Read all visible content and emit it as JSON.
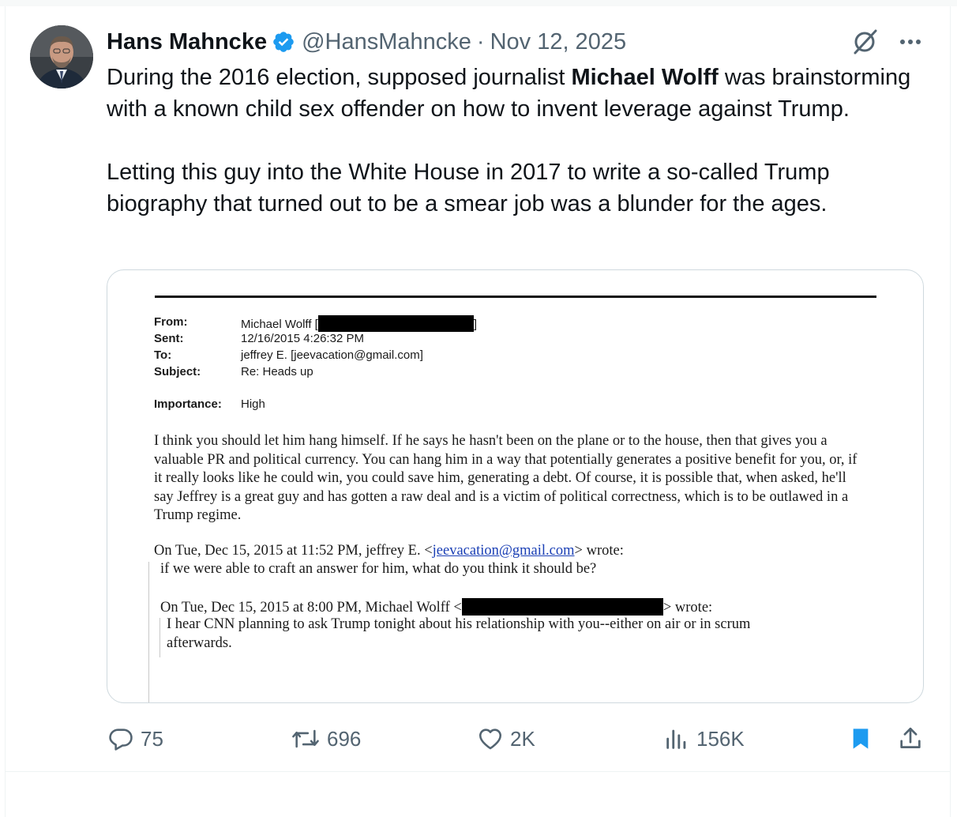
{
  "author": {
    "name": "Hans Mahncke",
    "handle": "@HansMahncke",
    "separator": "·",
    "date": "Nov 12, 2025"
  },
  "tweet": {
    "line1_before": "During the 2016 election, supposed journalist ",
    "line1_bold": "Michael Wolff",
    "line1_after": " was brainstorming with a known child sex offender on how to invent leverage against Trump.",
    "paragraph2": "Letting this guy into the White House in 2017 to write a so-called Trump biography that turned out to be a smear job was a blunder for the ages."
  },
  "document": {
    "from_label": "From:",
    "from_value": "Michael Wolff [",
    "from_close": "]",
    "sent_label": "Sent:",
    "sent_value": "12/16/2015 4:26:32 PM",
    "to_label": "To:",
    "to_value": "jeffrey E. [jeevacation@gmail.com]",
    "subject_label": "Subject:",
    "subject_value": "Re: Heads up",
    "importance_label": "Importance:",
    "importance_value": "High",
    "body": "I think you should let him hang himself. If he says he hasn't been on the plane or to the house, then that gives you a valuable PR and political currency. You can hang him in a way that potentially generates a positive benefit for you, or, if it really looks like he could win, you could save him, generating a debt. Of course, it is possible that, when asked, he'll say Jeffrey is a great guy and has gotten a raw deal and is a victim of political correctness, which is to be outlawed in a Trump regime.",
    "quote1_before": "On Tue, Dec 15, 2015 at 11:52 PM, jeffrey E. <",
    "quote1_link": "jeevacation@gmail.com",
    "quote1_after": "> wrote:",
    "quote1_text": "if we were able to craft an answer for him,  what do you think it should be?",
    "quote2_before": "On Tue, Dec 15, 2015 at 8:00 PM, Michael Wolff <",
    "quote2_after": "> wrote:",
    "quote2_line1": "I hear CNN planning to ask Trump tonight about his relationship with you--either on air or in scrum",
    "quote2_line2": "afterwards."
  },
  "actions": {
    "replies": "75",
    "reposts": "696",
    "likes": "2K",
    "views": "156K"
  },
  "icons": {
    "verified": "verified-badge-icon",
    "grok": "grok-icon",
    "more": "more-icon",
    "reply": "reply-icon",
    "repost": "repost-icon",
    "like": "like-icon",
    "views": "views-icon",
    "bookmark": "bookmark-icon",
    "share": "share-icon"
  },
  "colors": {
    "verified": "#1d9bf0",
    "muted": "#536471",
    "bookmark_active": "#1d9bf0",
    "text": "#0f1419"
  }
}
